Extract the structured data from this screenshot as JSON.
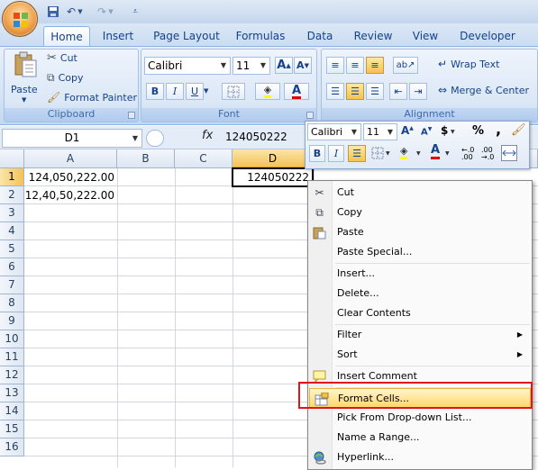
{
  "qat": {
    "save": "save-icon",
    "undo": "undo-icon",
    "redo": "redo-icon"
  },
  "tabs": [
    "Home",
    "Insert",
    "Page Layout",
    "Formulas",
    "Data",
    "Review",
    "View",
    "Developer"
  ],
  "clipboard": {
    "paste": "Paste",
    "cut": "Cut",
    "copy": "Copy",
    "format_painter": "Format Painter",
    "label": "Clipboard"
  },
  "font": {
    "name": "Calibri",
    "size": "11",
    "bold": "B",
    "italic": "I",
    "underline": "U",
    "grow": "A",
    "shrink": "A",
    "label": "Font",
    "font_color": "A"
  },
  "alignment": {
    "wrap": "Wrap Text",
    "merge": "Merge & Center",
    "label": "Alignment"
  },
  "formula_bar": {
    "name_box": "D1",
    "fx": "fx",
    "value": "124050222"
  },
  "columns": [
    "A",
    "B",
    "C",
    "D"
  ],
  "rows": [
    "1",
    "2",
    "3",
    "4",
    "5",
    "6",
    "7",
    "8",
    "9",
    "10",
    "11",
    "12",
    "13",
    "14",
    "15",
    "16"
  ],
  "cells": {
    "a1": "124,050,222.00",
    "a2": "12,40,50,222.00",
    "d1": "124050222"
  },
  "mini_toolbar": {
    "font": "Calibri",
    "size": "11",
    "currency": "$",
    "percent": "%",
    "comma": ",",
    "bold": "B",
    "italic": "I",
    "font_color": "A"
  },
  "context_menu": {
    "cut": "Cut",
    "copy": "Copy",
    "paste": "Paste",
    "paste_special": "Paste Special...",
    "insert": "Insert...",
    "delete": "Delete...",
    "clear_contents": "Clear Contents",
    "filter": "Filter",
    "sort": "Sort",
    "insert_comment": "Insert Comment",
    "format_cells": "Format Cells...",
    "pick_from_list": "Pick From Drop-down List...",
    "name_range": "Name a Range...",
    "hyperlink": "Hyperlink..."
  },
  "colors": {
    "highlight": "#e0141e",
    "selected_item": "#ffd86b",
    "ribbon": "#dbe7f6"
  }
}
